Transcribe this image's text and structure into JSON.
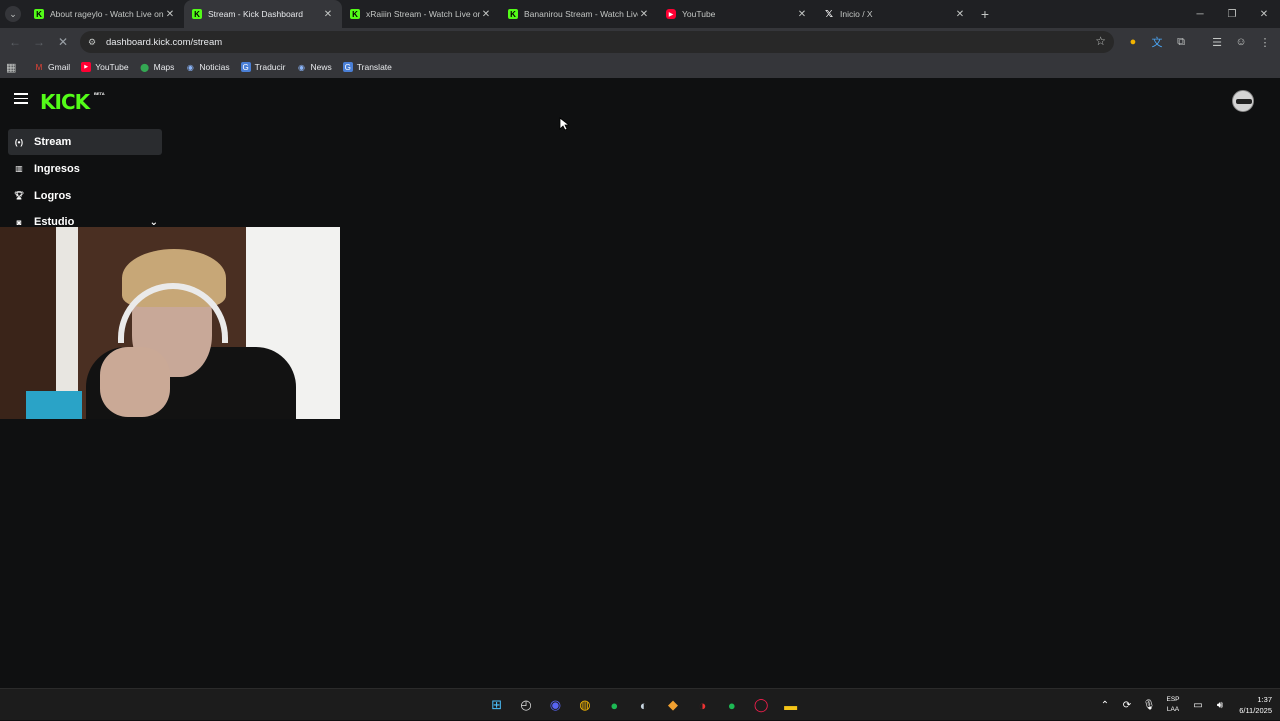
{
  "browser": {
    "tabs": [
      {
        "title": "About rageylo - Watch Live on",
        "favicon": "kick-icon"
      },
      {
        "title": "Stream - Kick Dashboard",
        "favicon": "kick-icon",
        "active": true
      },
      {
        "title": "xRaiiin Stream - Watch Live on",
        "favicon": "kick-icon"
      },
      {
        "title": "Bananirou Stream - Watch Live",
        "favicon": "kick-icon"
      },
      {
        "title": "YouTube",
        "favicon": "youtube-icon"
      },
      {
        "title": "Inicio / X",
        "favicon": "x-icon"
      }
    ],
    "url": "dashboard.kick.com/stream",
    "bookmarks": [
      {
        "label": "Gmail",
        "icon": "gmail-icon"
      },
      {
        "label": "YouTube",
        "icon": "youtube-icon"
      },
      {
        "label": "Maps",
        "icon": "maps-icon"
      },
      {
        "label": "Noticias",
        "icon": "news-icon"
      },
      {
        "label": "Traducir",
        "icon": "translate-icon"
      },
      {
        "label": "News",
        "icon": "news-icon"
      },
      {
        "label": "Translate",
        "icon": "translate-icon"
      }
    ]
  },
  "kick": {
    "logo": "KICK",
    "logo_badge": "BETA",
    "nav": [
      {
        "label": "Stream",
        "icon": "broadcast-icon",
        "active": true
      },
      {
        "label": "Ingresos",
        "icon": "chart-icon"
      },
      {
        "label": "Logros",
        "icon": "trophy-icon"
      },
      {
        "label": "Estudio",
        "icon": "camera-icon",
        "expandable": true
      }
    ]
  },
  "taskbar": {
    "language": [
      "ESP",
      "LAA"
    ],
    "time": "1:37",
    "date": "6/11/2025"
  },
  "colors": {
    "kick_green": "#53fc18",
    "page_bg": "#0f1011",
    "chrome_bg": "#35363a"
  }
}
